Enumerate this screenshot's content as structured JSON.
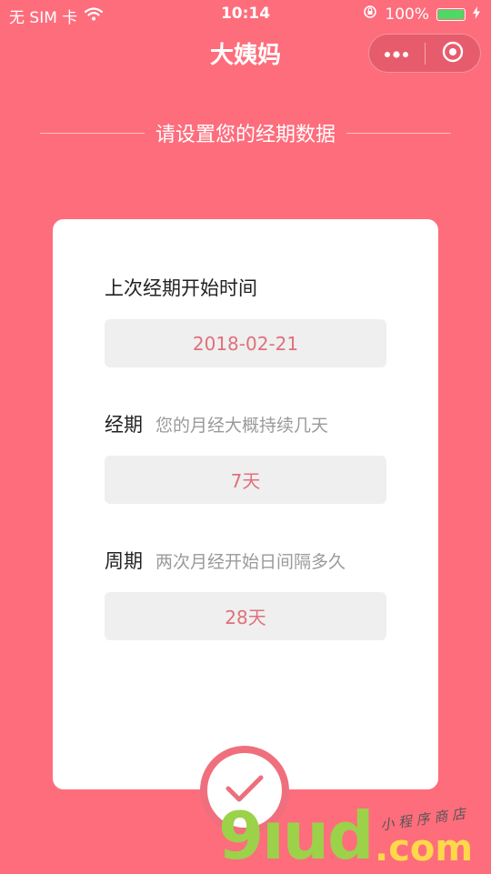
{
  "status_bar": {
    "carrier": "无 SIM 卡",
    "time": "10:14",
    "battery_percent": "100%",
    "battery_level": 1.0
  },
  "nav": {
    "title": "大姨妈"
  },
  "heading": "请设置您的经期数据",
  "form": {
    "last_period": {
      "label": "上次经期开始时间",
      "value": "2018-02-21"
    },
    "duration": {
      "label": "经期",
      "hint": "您的月经大概持续几天",
      "value": "7天"
    },
    "cycle": {
      "label": "周期",
      "hint": "两次月经开始日间隔多久",
      "value": "28天"
    }
  },
  "watermark": {
    "main": "9ıud",
    "suffix": ".com",
    "tagline": "小 程 序 商 店"
  },
  "colors": {
    "background": "#fe6d7c",
    "accent": "#e0707c",
    "card": "#ffffff",
    "field": "#efefef"
  },
  "icons": {
    "wifi": "wifi-icon",
    "orientation_lock": "orientation-lock-icon",
    "battery": "battery-icon",
    "charging": "charging-bolt-icon",
    "more": "more-dots-icon",
    "close": "close-target-icon",
    "confirm": "checkmark-icon"
  }
}
